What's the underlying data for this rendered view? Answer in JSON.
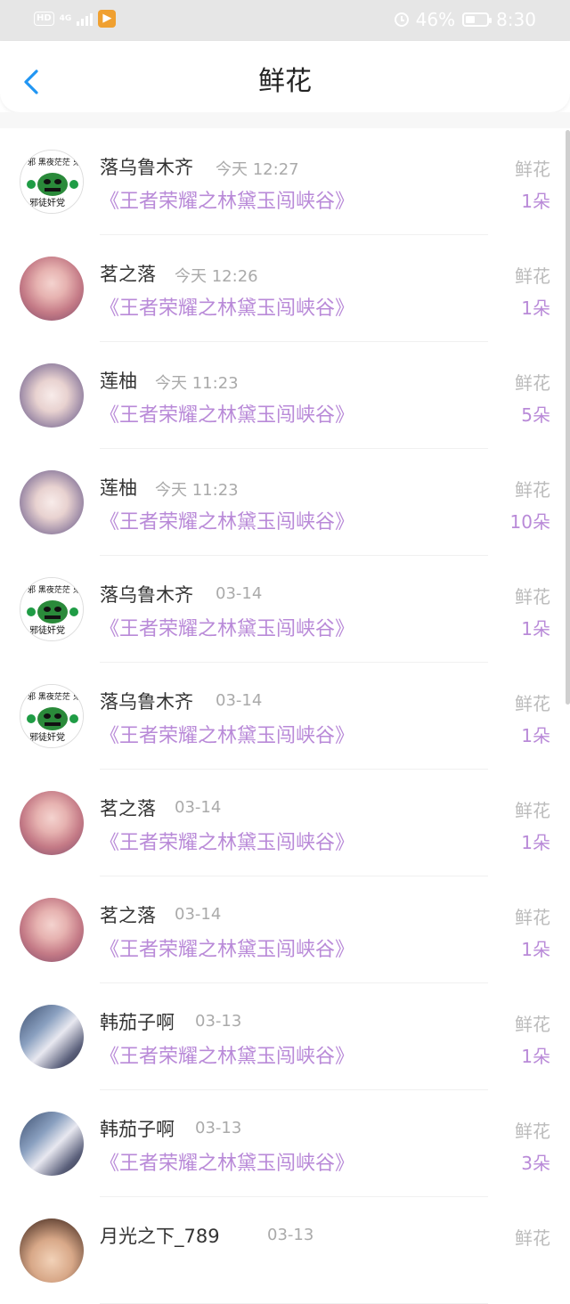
{
  "status_bar": {
    "hd_label": "HD",
    "network": "4G",
    "battery_percent": "46%",
    "battery_level": 0.46,
    "time": "8:30"
  },
  "header": {
    "title": "鲜花",
    "back_icon": "chevron-left-icon"
  },
  "colors": {
    "accent_purple": "#b98ad8",
    "back_blue": "#2196f3",
    "status_bar_bg": "#e6e6e6"
  },
  "records": [
    {
      "user": "落乌鲁木齐",
      "time": "今天 12:27",
      "book": "《王者荣耀之林黛玉闯峡谷》",
      "gift": "鲜花",
      "count": "1朵",
      "avatar": "meme"
    },
    {
      "user": "茗之落",
      "time": "今天 12:26",
      "book": "《王者荣耀之林黛玉闯峡谷》",
      "gift": "鲜花",
      "count": "1朵",
      "avatar": "pink"
    },
    {
      "user": "莲柚",
      "time": "今天 11:23",
      "book": "《王者荣耀之林黛玉闯峡谷》",
      "gift": "鲜花",
      "count": "5朵",
      "avatar": "girl"
    },
    {
      "user": "莲柚",
      "time": "今天 11:23",
      "book": "《王者荣耀之林黛玉闯峡谷》",
      "gift": "鲜花",
      "count": "10朵",
      "avatar": "girl"
    },
    {
      "user": "落乌鲁木齐",
      "time": "03-14",
      "book": "《王者荣耀之林黛玉闯峡谷》",
      "gift": "鲜花",
      "count": "1朵",
      "avatar": "meme"
    },
    {
      "user": "落乌鲁木齐",
      "time": "03-14",
      "book": "《王者荣耀之林黛玉闯峡谷》",
      "gift": "鲜花",
      "count": "1朵",
      "avatar": "meme"
    },
    {
      "user": "茗之落",
      "time": "03-14",
      "book": "《王者荣耀之林黛玉闯峡谷》",
      "gift": "鲜花",
      "count": "1朵",
      "avatar": "pink"
    },
    {
      "user": "茗之落",
      "time": "03-14",
      "book": "《王者荣耀之林黛玉闯峡谷》",
      "gift": "鲜花",
      "count": "1朵",
      "avatar": "pink"
    },
    {
      "user": "韩茄子啊",
      "time": "03-13",
      "book": "《王者荣耀之林黛玉闯峡谷》",
      "gift": "鲜花",
      "count": "1朵",
      "avatar": "knight"
    },
    {
      "user": "韩茄子啊",
      "time": "03-13",
      "book": "《王者荣耀之林黛玉闯峡谷》",
      "gift": "鲜花",
      "count": "3朵",
      "avatar": "knight"
    },
    {
      "user": "月光之下_789",
      "time": "03-13",
      "book": "",
      "gift": "鲜花",
      "count": "",
      "avatar": "woman"
    }
  ]
}
